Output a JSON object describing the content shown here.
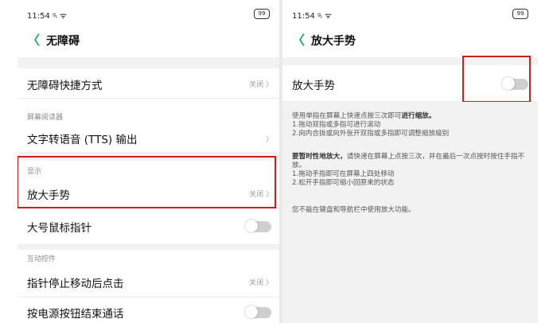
{
  "left": {
    "status_time": "11:54 ᵍₗ ᯤ",
    "battery": "99",
    "back_glyph": "〈",
    "title": "无障碍",
    "items": {
      "shortcut": {
        "label": "无障碍快捷方式",
        "value": "关闭 〉"
      },
      "tts": {
        "label": "文字转语音 (TTS) 输出",
        "value": "〉"
      },
      "magnify": {
        "label": "放大手势",
        "value": "关闭 〉"
      },
      "big_pointer": {
        "label": "大号鼠标指针"
      },
      "click_after_stop": {
        "label": "指针停止移动后点击",
        "value": "关闭 〉"
      },
      "power_end_call": {
        "label": "按电源按钮结束通话"
      }
    },
    "sections": {
      "screen_reader": "屏幕阅读器",
      "display": "显示",
      "interaction": "互动控件"
    }
  },
  "right": {
    "status_time": "11:54 ᵍₗ ᯤ",
    "battery": "99",
    "back_glyph": "〈",
    "title": "放大手势",
    "toggle_label": "放大手势",
    "desc1_intro": "使用单指在屏幕上快速点按三次即可",
    "desc1_bold": "进行缩放。",
    "desc1_l1": "1.拖动双指或多指可进行滚动",
    "desc1_l2": "2.向内合拢或向外张开双指或多指即可调整缩放级别",
    "desc2_bold": "要暂时性地放大，",
    "desc2_intro": "请快速在屏幕上点按三次，并在最后一次点按时按住手指不放。",
    "desc2_l1": "1.拖动手指即可在屏幕上四处移动",
    "desc2_l2": "2.松开手指即可缩小回原来的状态",
    "desc3": "您不能在键盘和导航栏中使用放大功能。"
  },
  "colors": {
    "accent": "#25a55a",
    "highlight": "#cc1e1e"
  },
  "toggles": {
    "magnify": false,
    "big_pointer": false,
    "power_end_call": false
  }
}
